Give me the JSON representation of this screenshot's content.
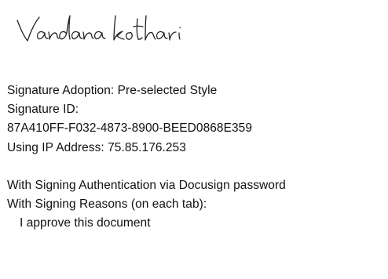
{
  "signature": {
    "signer_name": "Vandana kothari"
  },
  "details": {
    "adoption": "Signature Adoption: Pre-selected Style",
    "id_label": "Signature ID:",
    "id_value": "87A410FF-F032-4873-8900-BEED0868E359",
    "ip": "Using IP Address: 75.85.176.253",
    "authentication": "With Signing Authentication via Docusign password",
    "reasons_label": "With Signing Reasons (on each tab):",
    "reason": "I approve this document"
  },
  "colors": {
    "ink": "#222222",
    "text": "#111111",
    "background": "#ffffff"
  }
}
